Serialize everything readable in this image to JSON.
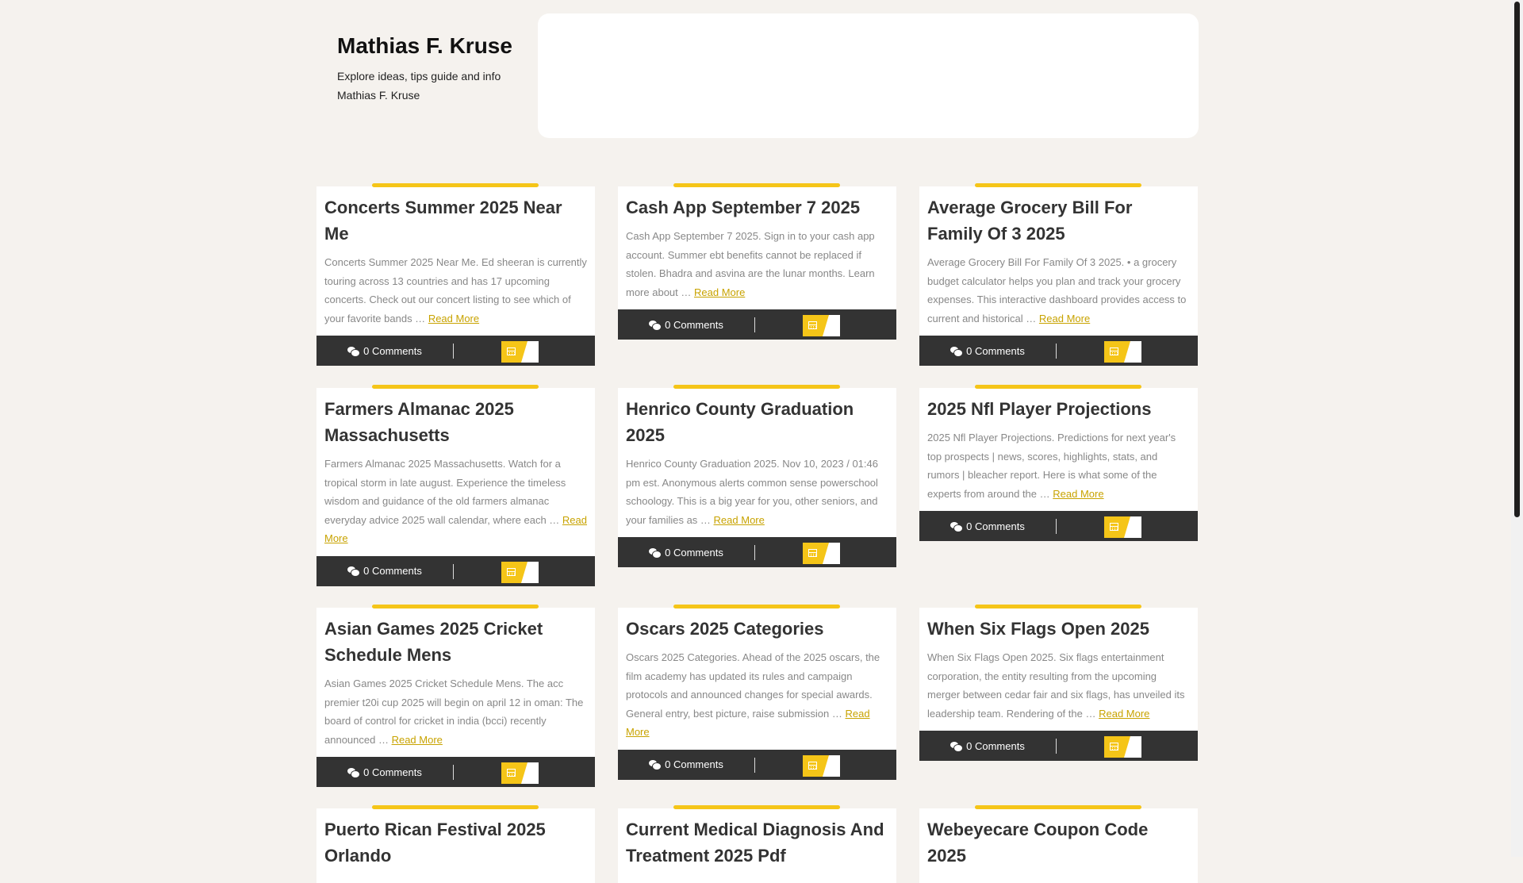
{
  "site": {
    "title": "Mathias F. Kruse",
    "description": "Explore ideas, tips guide and info Mathias F. Kruse"
  },
  "read_more_label": "Read More",
  "icons": {
    "comments": "comments-icon",
    "date": "calendar-icon"
  },
  "colors": {
    "accent": "#f5c518",
    "footer": "#333333",
    "background": "#f5f2ee"
  },
  "posts": [
    {
      "title": "Concerts Summer 2025 Near Me",
      "excerpt": "Concerts Summer 2025 Near Me. Ed sheeran is currently touring across 13 countries and has 17 upcoming concerts. Check out our concert listing to see which of your favorite bands …",
      "comments": "0 Comments"
    },
    {
      "title": "Cash App September 7 2025",
      "excerpt": "Cash App September 7 2025. Sign in to your cash app account. Summer ebt benefits cannot be replaced if stolen. Bhadra and asvina are the lunar months. Learn more about …",
      "comments": "0 Comments"
    },
    {
      "title": "Average Grocery Bill For Family Of 3 2025",
      "excerpt": "Average Grocery Bill For Family Of 3 2025. • a grocery budget calculator helps you plan and track your grocery expenses. This interactive dashboard provides access to current and historical …",
      "comments": "0 Comments"
    },
    {
      "title": "Farmers Almanac 2025 Massachusetts",
      "excerpt": "Farmers Almanac 2025 Massachusetts. Watch for a tropical storm in late august. Experience the timeless wisdom and guidance of the old farmers almanac everyday advice 2025 wall calendar, where each …",
      "comments": "0 Comments"
    },
    {
      "title": "Henrico County Graduation 2025",
      "excerpt": "Henrico County Graduation 2025. Nov 10, 2023 / 01:46 pm est. Anonymous alerts common sense powerschool schoology. This is a big year for you, other seniors, and your families as …",
      "comments": "0 Comments"
    },
    {
      "title": "2025 Nfl Player Projections",
      "excerpt": "2025 Nfl Player Projections. Predictions for next year's top prospects | news, scores, highlights, stats, and rumors | bleacher report. Here is what some of the experts from around the …",
      "comments": "0 Comments"
    },
    {
      "title": "Asian Games 2025 Cricket Schedule Mens",
      "excerpt": "Asian Games 2025 Cricket Schedule Mens. The acc premier t20i cup 2025 will begin on april 12 in oman: The board of control for cricket in india (bcci) recently announced …",
      "comments": "0 Comments"
    },
    {
      "title": "Oscars 2025 Categories",
      "excerpt": "Oscars 2025 Categories. Ahead of the 2025 oscars, the film academy has updated its rules and campaign protocols and announced changes for special awards. General entry, best picture, raise submission …",
      "comments": "0 Comments"
    },
    {
      "title": "When Six Flags Open 2025",
      "excerpt": "When Six Flags Open 2025. Six flags entertainment corporation, the entity resulting from the upcoming merger between cedar fair and six flags, has unveiled its leadership team. Rendering of the …",
      "comments": "0 Comments"
    },
    {
      "title": "Puerto Rican Festival 2025 Orlando",
      "excerpt": "",
      "comments": ""
    },
    {
      "title": "Current Medical Diagnosis And Treatment 2025 Pdf",
      "excerpt": "",
      "comments": ""
    },
    {
      "title": "Webeyecare Coupon Code 2025",
      "excerpt": "",
      "comments": ""
    }
  ]
}
